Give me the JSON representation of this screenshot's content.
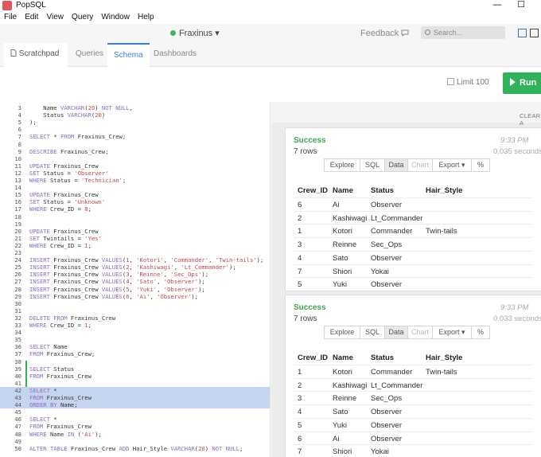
{
  "app": {
    "title": "PopSQL",
    "window_controls": {
      "minimize": "—",
      "maximize": "☐"
    }
  },
  "menu": [
    "File",
    "Edit",
    "View",
    "Query",
    "Window",
    "Help"
  ],
  "topbar": {
    "connection": "Fraxinus ▾",
    "feedback": "Feedback",
    "search_placeholder": "Search..."
  },
  "tabs": [
    {
      "label": "Scratchpad ✖",
      "icon": "document-icon"
    },
    {
      "label": "Queries"
    },
    {
      "label": "Schema"
    },
    {
      "label": "Dashboards"
    }
  ],
  "runbar": {
    "limit_label": "Limit 100",
    "run_label": "Run"
  },
  "editor": {
    "lines": [
      {
        "n": "3",
        "code": "    Name VARCHAR(20) NOT NULL,"
      },
      {
        "n": "4",
        "code": "    Status VARCHAR(20)"
      },
      {
        "n": "5",
        "code": ");"
      },
      {
        "n": "6",
        "code": ""
      },
      {
        "n": "7",
        "code": "SELECT * FROM Fraxinus_Crew;"
      },
      {
        "n": "8",
        "code": ""
      },
      {
        "n": "9",
        "code": "DESCRIBE Fraxinus_Crew;"
      },
      {
        "n": "10",
        "code": ""
      },
      {
        "n": "11",
        "code": "UPDATE Fraxinus_Crew"
      },
      {
        "n": "12",
        "code": "SET Status = 'Observer'"
      },
      {
        "n": "13",
        "code": "WHERE Status = 'Technician';"
      },
      {
        "n": "14",
        "code": ""
      },
      {
        "n": "15",
        "code": "UPDATE Fraxinus_Crew"
      },
      {
        "n": "16",
        "code": "SET Status = 'Unknown'"
      },
      {
        "n": "17",
        "code": "WHERE Crew_ID = 8;"
      },
      {
        "n": "18",
        "code": ""
      },
      {
        "n": "19",
        "code": ""
      },
      {
        "n": "20",
        "code": "UPDATE Fraxinus_Crew"
      },
      {
        "n": "21",
        "code": "SET Twintails = 'Yes'"
      },
      {
        "n": "22",
        "code": "WHERE Crew_ID = 1;"
      },
      {
        "n": "23",
        "code": ""
      },
      {
        "n": "24",
        "code": "INSERT Fraxinus_Crew VALUES(1, 'Kotori', 'Commander', 'Twin-tails');"
      },
      {
        "n": "25",
        "code": "INSERT Fraxinus_Crew VALUES(2, 'Kashiwagi', 'Lt_Commander');"
      },
      {
        "n": "26",
        "code": "INSERT Fraxinus_Crew VALUES(3, 'Reinne', 'Sec_Ops');"
      },
      {
        "n": "27",
        "code": "INSERT Fraxinus_Crew VALUES(4, 'Sato', 'Observer');"
      },
      {
        "n": "28",
        "code": "INSERT Fraxinus_Crew VALUES(5, 'Yuki', 'Observer');"
      },
      {
        "n": "29",
        "code": "INSERT Fraxinus_Crew VALUES(6, 'Ai', 'Observer');"
      },
      {
        "n": "30",
        "code": ""
      },
      {
        "n": "31",
        "code": ""
      },
      {
        "n": "32",
        "code": "DELETE FROM Fraxinus_Crew"
      },
      {
        "n": "33",
        "code": "WHERE Crew_ID = 1;"
      },
      {
        "n": "34",
        "code": ""
      },
      {
        "n": "35",
        "code": ""
      },
      {
        "n": "36",
        "code": "SELECT Name"
      },
      {
        "n": "37",
        "code": "FROM Fraxinus_Crew;"
      },
      {
        "n": "38",
        "code": ""
      },
      {
        "n": "39",
        "code": "SELECT Status"
      },
      {
        "n": "40",
        "code": "FROM Fraxinus_Crew"
      },
      {
        "n": "41",
        "code": ""
      },
      {
        "n": "42",
        "code": "SELECT *",
        "highlight": true
      },
      {
        "n": "43",
        "code": "FROM Fraxinus_Crew",
        "highlight": true
      },
      {
        "n": "44",
        "code": "ORDER BY Name;",
        "highlight": true
      },
      {
        "n": "45",
        "code": ""
      },
      {
        "n": "46",
        "code": "SELECT *"
      },
      {
        "n": "47",
        "code": "FROM Fraxinus_Crew"
      },
      {
        "n": "48",
        "code": "WHERE Name IN ('Ai');"
      },
      {
        "n": "49",
        "code": ""
      },
      {
        "n": "50",
        "code": "ALTER TABLE Fraxinus_Crew ADD Hair_Style VARCHAR(20) NOT NULL;"
      }
    ]
  },
  "results": {
    "clear_all": "CLEAR A",
    "view_buttons": [
      "Explore",
      "SQL",
      "Data",
      "Chart",
      "Export ▾",
      "%"
    ],
    "columns": [
      "Crew_ID",
      "Name",
      "Status",
      "Hair_Style"
    ],
    "cards": [
      {
        "status": "Success",
        "rows_label": "7 rows",
        "time": "9:33 PM",
        "duration": "0.035 seconds",
        "rows": [
          [
            "6",
            "Ai",
            "Observer",
            ""
          ],
          [
            "2",
            "Kashiwagi",
            "Lt_Commander",
            ""
          ],
          [
            "1",
            "Kotori",
            "Commander",
            "Twin-tails"
          ],
          [
            "3",
            "Reinne",
            "Sec_Ops",
            ""
          ],
          [
            "4",
            "Sato",
            "Observer",
            ""
          ],
          [
            "7",
            "Shiori",
            "Yokai",
            ""
          ],
          [
            "5",
            "Yuki",
            "Observer",
            ""
          ]
        ]
      },
      {
        "status": "Success",
        "rows_label": "7 rows",
        "time": "9:33 PM",
        "duration": "0.033 seconds",
        "rows": [
          [
            "1",
            "Kotori",
            "Commander",
            "Twin-tails"
          ],
          [
            "2",
            "Kashiwagi",
            "Lt_Commander",
            ""
          ],
          [
            "3",
            "Reinne",
            "Sec_Ops",
            ""
          ],
          [
            "4",
            "Sato",
            "Observer",
            ""
          ],
          [
            "5",
            "Yuki",
            "Observer",
            ""
          ],
          [
            "6",
            "Ai",
            "Observer",
            ""
          ],
          [
            "7",
            "Shiori",
            "Yokai",
            ""
          ]
        ]
      }
    ]
  },
  "colors": {
    "accent": "#3c7ecb",
    "run": "#2fb35a",
    "success": "#3ca84a",
    "selection": "#c5d5ef"
  }
}
